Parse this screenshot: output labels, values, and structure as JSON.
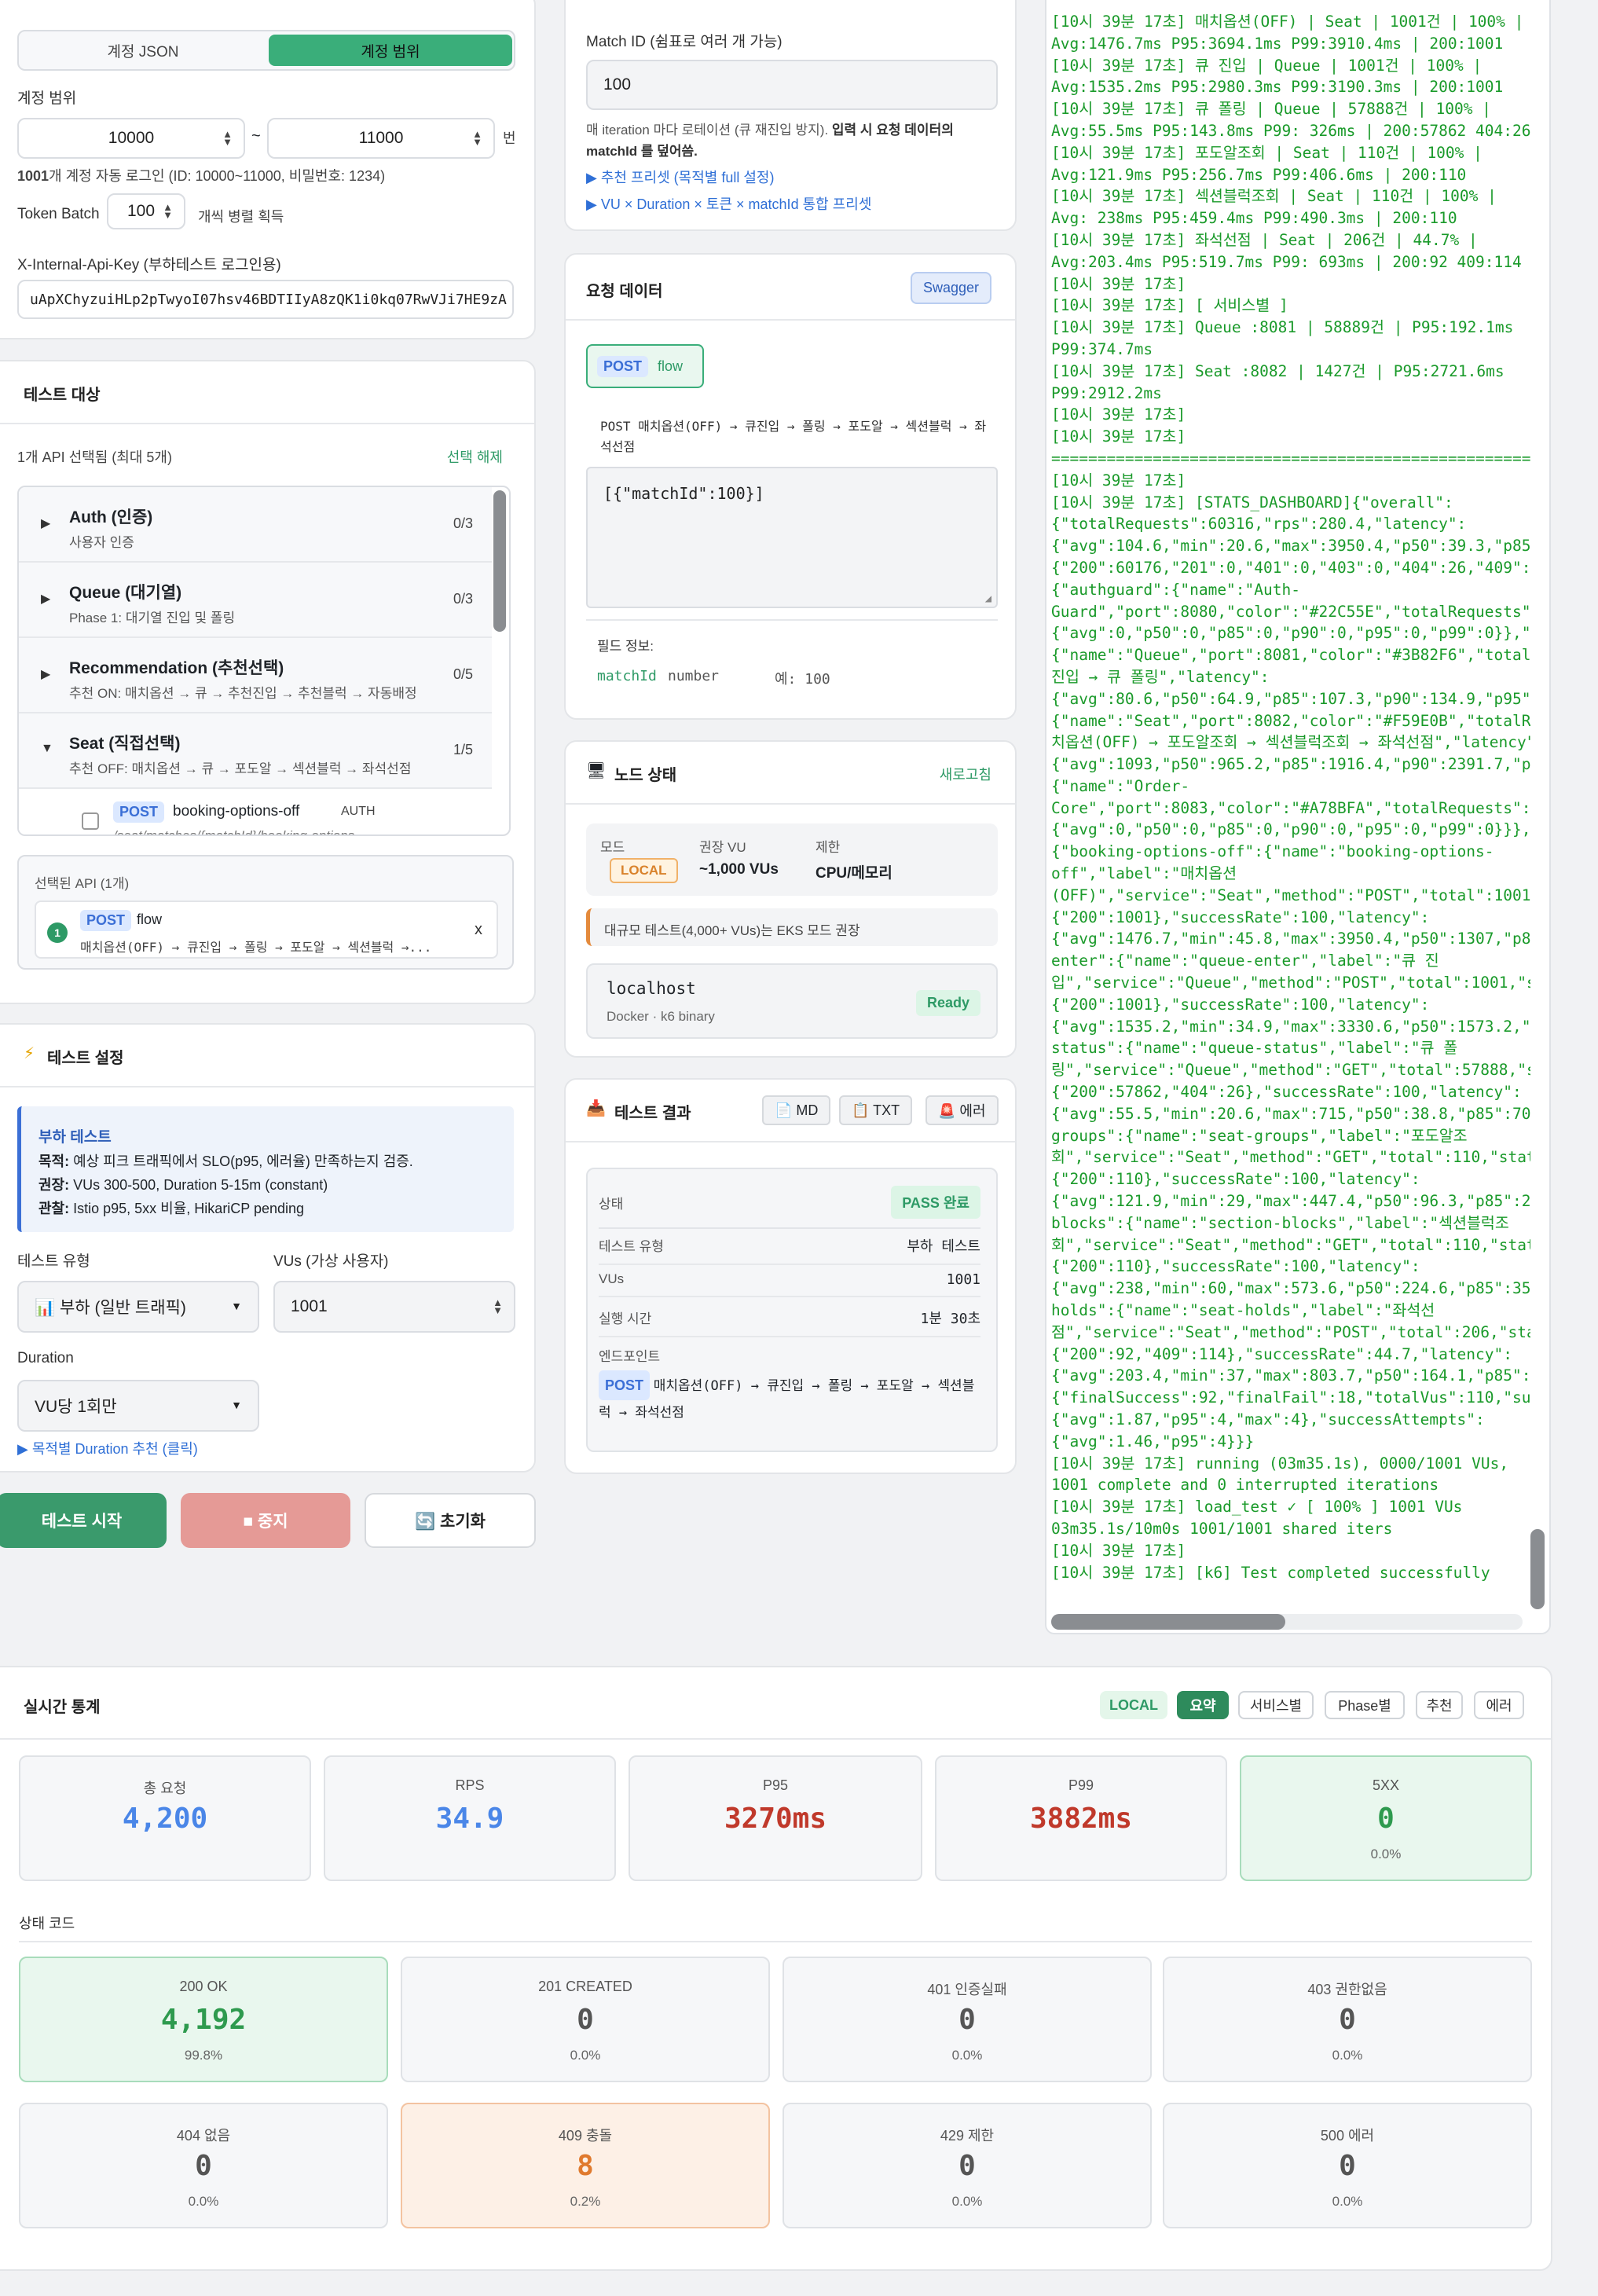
{
  "account": {
    "tab_json": "계정 JSON",
    "tab_range": "계정 범위",
    "range_label": "계정 범위",
    "range_from": "10000",
    "range_sep": "~",
    "range_to": "11000",
    "range_unit": "번",
    "auto_login_count": "1001",
    "auto_login_text": "개 계정 자동 로그인 (ID: 10000~11000, 비밀번호: 1234)",
    "token_batch_label": "Token Batch",
    "token_batch_value": "100",
    "token_batch_hint": "개씩 병렬 획득",
    "api_key_label": "X-Internal-Api-Key (부하테스트 로그인용)",
    "api_key_value": "uApXChyzuiHLp2pTwyoI07hsv46BDTIIyA8zQK1i0kq07RwVJi7HE9zA"
  },
  "targets": {
    "title": "테스트 대상",
    "selected_info": "1개 API 선택됨 (최대 5개)",
    "clear_label": "선택 해제",
    "groups": [
      {
        "title": "Auth (인증)",
        "sub": "사용자 인증",
        "count": "0/3",
        "arrow": "▶"
      },
      {
        "title": "Queue (대기열)",
        "sub": "Phase 1: 대기열 진입 및 폴링",
        "count": "0/3",
        "arrow": "▶"
      },
      {
        "title": "Recommendation (추천선택)",
        "sub": "추천 ON: 매치옵션 → 큐 → 추천진입 → 추천블럭 → 자동배정",
        "count": "0/5",
        "arrow": "▶"
      },
      {
        "title": "Seat (직접선택)",
        "sub": "추천 OFF: 매치옵션 → 큐 → 포도알 → 섹션블럭 → 좌석선점",
        "count": "1/5",
        "arrow": "▼"
      }
    ],
    "sub_item_method": "POST",
    "sub_item_name": "booking-options-off",
    "sub_item_auth": "AUTH",
    "sub_item_path": "/seat/matches/{matchId}/booking-options",
    "selected_title": "선택된 API (1개)",
    "selected_num": "1",
    "selected_method": "POST",
    "selected_name": "flow",
    "selected_desc": "매치옵션(OFF) → 큐진입 → 폴링 → 포도알 → 섹션블럭 →...",
    "remove": "x"
  },
  "settings": {
    "title": "테스트 설정",
    "box_title": "부하 테스트",
    "goal_k": "목적:",
    "goal_v": " 예상 피크 트래픽에서 SLO(p95, 에러율) 만족하는지 검증.",
    "rec_k": "권장:",
    "rec_v": " VUs 300-500, Duration 5-15m (constant)",
    "obs_k": "관찰:",
    "obs_v": " Istio p95, 5xx 비율, HikariCP pending",
    "type_label": "테스트 유형",
    "type_value": "📊 부하 (일반 트래픽)",
    "vus_label": "VUs (가상 사용자)",
    "vus_value": "1001",
    "duration_label": "Duration",
    "duration_value": "VU당 1회만",
    "duration_link": "▶ 목적별 Duration 추천 (클릭)"
  },
  "actions": {
    "start": "테스트 시작",
    "stop": "■ 중지",
    "reset": "🔄 초기화"
  },
  "match": {
    "label": "Match ID (쉼표로 여러 개 가능)",
    "value": "100",
    "hint_a": "매 iteration 마다 로테이션 (큐 재진입 방지). ",
    "hint_b": "입력 시 요청 데이터의 matchId 를 덮어씀.",
    "preset_link": "▶ 추천 프리셋 (목적별 full 설정)",
    "combo_link": "▶ VU × Duration × 토큰 × matchId 통합 프리셋"
  },
  "request": {
    "title": "요청 데이터",
    "swagger": "Swagger",
    "method": "POST",
    "name": "flow",
    "desc": "POST 매치옵션(OFF) → 큐진입 → 폴링 → 포도알 → 섹션블럭 → 좌석선점",
    "body": "[{\"matchId\":100}]",
    "field_label": "필드 정보:",
    "field_name": "matchId",
    "field_type": "number",
    "field_example": "예: 100"
  },
  "node": {
    "title": "노드 상태",
    "refresh": "새로고침",
    "mode_label": "모드",
    "mode_value": "LOCAL",
    "vu_label": "권장 VU",
    "vu_value": "~1,000 VUs",
    "limit_label": "제한",
    "limit_value": "CPU/메모리",
    "warn": "대규모 테스트(4,000+ VUs)는 EKS 모드 권장",
    "host": "localhost",
    "host_sub": "Docker · k6 binary",
    "ready": "Ready"
  },
  "result": {
    "title": "테스트 결과",
    "btn_md": "📄 MD",
    "btn_txt": "📋 TXT",
    "btn_err": "🚨 에러",
    "status_label": "상태",
    "status_value": "PASS 완료",
    "type_label": "테스트 유형",
    "type_value": "부하 테스트",
    "vus_label": "VUs",
    "vus_value": "1001",
    "time_label": "실행 시간",
    "time_value": "1분 30초",
    "endpoint_label": "엔드포인트",
    "endpoint_method": "POST",
    "endpoint_value": "매치옵션(OFF) → 큐진입 → 폴링 → 포도알 → 섹션블럭 → 좌석선점"
  },
  "log": {
    "text": "[10시 39분 17초] 매치옵션(OFF) | Seat | 1001건 | 100% |\nAvg:1476.7ms P95:3694.1ms P99:3910.4ms | 200:1001\n[10시 39분 17초] 큐 진입 | Queue | 1001건 | 100% |\nAvg:1535.2ms P95:2980.3ms P99:3190.3ms | 200:1001\n[10시 39분 17초] 큐 폴링 | Queue | 57888건 | 100% |\nAvg:55.5ms P95:143.8ms P99: 326ms | 200:57862 404:26\n[10시 39분 17초] 포도알조회 | Seat | 110건 | 100% |\nAvg:121.9ms P95:256.7ms P99:406.6ms | 200:110\n[10시 39분 17초] 섹션블럭조회 | Seat | 110건 | 100% |\nAvg: 238ms P95:459.4ms P99:490.3ms | 200:110\n[10시 39분 17초] 좌석선점 | Seat | 206건 | 44.7% |\nAvg:203.4ms P95:519.7ms P99: 693ms | 200:92 409:114\n[10시 39분 17초]\n[10시 39분 17초] [ 서비스별 ]\n[10시 39분 17초] Queue :8081 | 58889건 | P95:192.1ms\nP99:374.7ms\n[10시 39분 17초] Seat :8082 | 1427건 | P95:2721.6ms\nP99:2912.2ms\n[10시 39분 17초]\n[10시 39분 17초]\n===============================================================\n[10시 39분 17초]\n[10시 39분 17초] [STATS_DASHBOARD]{\"overall\":\n{\"totalRequests\":60316,\"rps\":280.4,\"latency\":\n{\"avg\":104.6,\"min\":20.6,\"max\":3950.4,\"p50\":39.3,\"p85\":8\n{\"200\":60176,\"201\":0,\"401\":0,\"403\":0,\"404\":26,\"409\":114\n{\"authguard\":{\"name\":\"Auth-\nGuard\",\"port\":8080,\"color\":\"#22C55E\",\"totalRequests\":0,\n{\"avg\":0,\"p50\":0,\"p85\":0,\"p90\":0,\"p95\":0,\"p99\":0}},\"que\n{\"name\":\"Queue\",\"port\":8081,\"color\":\"#3B82F6\",\"totalReq\n진입 → 큐 폴링\",\"latency\":\n{\"avg\":80.6,\"p50\":64.9,\"p85\":107.3,\"p90\":134.9,\"p95\":19\n{\"name\":\"Seat\",\"port\":8082,\"color\":\"#F59E0B\",\"totalRequ\n치옵션(OFF) → 포도알조회 → 섹션블럭조회 → 좌석선점\",\"latency\":\n{\"avg\":1093,\"p50\":965.2,\"p85\":1916.4,\"p90\":2391.7,\"p95\"\n{\"name\":\"Order-\nCore\",\"port\":8083,\"color\":\"#A78BFA\",\"totalRequests\":0,\"\n{\"avg\":0,\"p50\":0,\"p85\":0,\"p90\":0,\"p95\":0,\"p99\":0}}},\"ph\n{\"booking-options-off\":{\"name\":\"booking-options-\noff\",\"label\":\"매치옵션\n(OFF)\",\"service\":\"Seat\",\"method\":\"POST\",\"total\":1001,\"s\n{\"200\":1001},\"successRate\":100,\"latency\":\n{\"avg\":1476.7,\"min\":45.8,\"max\":3950.4,\"p50\":1307,\"p85\":\nenter\":{\"name\":\"queue-enter\",\"label\":\"큐 진\n입\",\"service\":\"Queue\",\"method\":\"POST\",\"total\":1001,\"stat\n{\"200\":1001},\"successRate\":100,\"latency\":\n{\"avg\":1535.2,\"min\":34.9,\"max\":3330.6,\"p50\":1573.2,\"p85\nstatus\":{\"name\":\"queue-status\",\"label\":\"큐 폴\n링\",\"service\":\"Queue\",\"method\":\"GET\",\"total\":57888,\"sta\n{\"200\":57862,\"404\":26},\"successRate\":100,\"latency\":\n{\"avg\":55.5,\"min\":20.6,\"max\":715,\"p50\":38.8,\"p85\":70.2,\ngroups\":{\"name\":\"seat-groups\",\"label\":\"포도알조\n회\",\"service\":\"Seat\",\"method\":\"GET\",\"total\":110,\"status\n{\"200\":110},\"successRate\":100,\"latency\":\n{\"avg\":121.9,\"min\":29,\"max\":447.4,\"p50\":96.3,\"p85\":209.\nblocks\":{\"name\":\"section-blocks\",\"label\":\"섹션블럭조\n회\",\"service\":\"Seat\",\"method\":\"GET\",\"total\":110,\"status\n{\"200\":110},\"successRate\":100,\"latency\":\n{\"avg\":238,\"min\":60,\"max\":573.6,\"p50\":224.6,\"p85\":354.3\nholds\":{\"name\":\"seat-holds\",\"label\":\"좌석선\n점\",\"service\":\"Seat\",\"method\":\"POST\",\"total\":206,\"statu\n{\"200\":92,\"409\":114},\"successRate\":44.7,\"latency\":\n{\"avg\":203.4,\"min\":37,\"max\":803.7,\"p50\":164.1,\"p85\":328\n{\"finalSuccess\":92,\"finalFail\":18,\"totalVus\":110,\"succe\n{\"avg\":1.87,\"p95\":4,\"max\":4},\"successAttempts\":\n{\"avg\":1.46,\"p95\":4}}}\n[10시 39분 17초] running (03m35.1s), 0000/1001 VUs,\n1001 complete and 0 interrupted iterations\n[10시 39분 17초] load_test ✓ [ 100% ] 1001 VUs\n03m35.1s/10m0s 1001/1001 shared iters\n[10시 39분 17초]\n[10시 39분 17초] [k6] Test completed successfully"
  },
  "realtime": {
    "title": "실시간 통계",
    "chips": [
      "LOCAL",
      "요약",
      "서비스별",
      "Phase별",
      "추천",
      "에러"
    ],
    "summary": [
      {
        "label": "총 요청",
        "value": "4,200",
        "pct": ""
      },
      {
        "label": "RPS",
        "value": "34.9",
        "pct": ""
      },
      {
        "label": "P95",
        "value": "3270ms",
        "pct": ""
      },
      {
        "label": "P99",
        "value": "3882ms",
        "pct": ""
      },
      {
        "label": "5XX",
        "value": "0",
        "pct": "0.0%"
      }
    ],
    "status_title": "상태 코드",
    "codes": [
      {
        "label": "200 OK",
        "value": "4,192",
        "pct": "99.8%"
      },
      {
        "label": "201 CREATED",
        "value": "0",
        "pct": "0.0%"
      },
      {
        "label": "401 인증실패",
        "value": "0",
        "pct": "0.0%"
      },
      {
        "label": "403 권한없음",
        "value": "0",
        "pct": "0.0%"
      },
      {
        "label": "404 없음",
        "value": "0",
        "pct": "0.0%"
      },
      {
        "label": "409 충돌",
        "value": "8",
        "pct": "0.2%"
      },
      {
        "label": "429 제한",
        "value": "0",
        "pct": "0.0%"
      },
      {
        "label": "500 에러",
        "value": "0",
        "pct": "0.0%"
      }
    ]
  },
  "colors": {
    "green": "#3aae7a",
    "red": "#c0392b",
    "blue": "#4a86e8",
    "orange": "#e07a2e"
  }
}
